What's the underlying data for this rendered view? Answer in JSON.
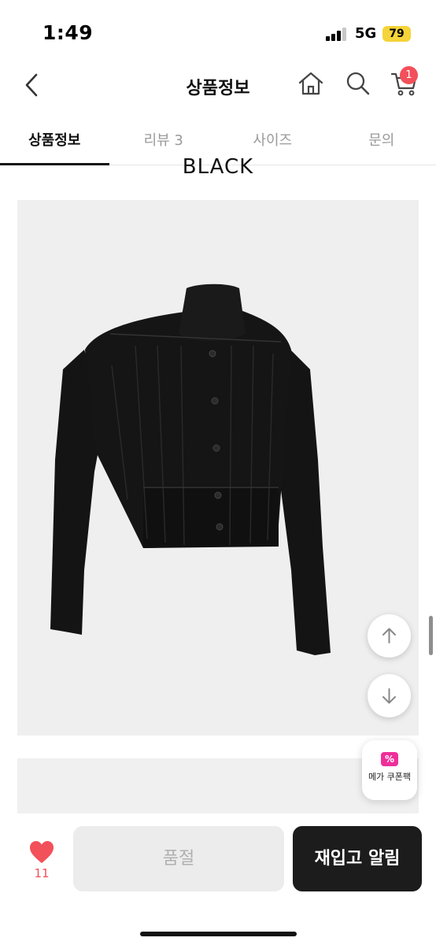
{
  "status_bar": {
    "time": "1:49",
    "network": "5G",
    "battery": "79"
  },
  "header": {
    "title": "상품정보",
    "cart_count": "1"
  },
  "tabs": [
    {
      "label": "상품정보",
      "active": true
    },
    {
      "label": "리뷰 3",
      "active": false
    },
    {
      "label": "사이즈",
      "active": false
    },
    {
      "label": "문의",
      "active": false
    }
  ],
  "content": {
    "color_label": "BLACK"
  },
  "coupon": {
    "label": "메가 쿠폰팩",
    "icon_glyph": "%"
  },
  "bottom_bar": {
    "like_count": "11",
    "soldout_label": "품절",
    "restock_label": "재입고 알림"
  },
  "icons": {
    "back": "chevron-left-icon",
    "home": "home-icon",
    "search": "search-icon",
    "cart": "cart-icon",
    "heart": "heart-icon",
    "up": "arrow-up-icon",
    "down": "arrow-down-icon",
    "coupon": "coupon-icon"
  },
  "colors": {
    "accent": "#f2505a",
    "coupon": "#ef2f9a",
    "primary_button": "#1c1c1c",
    "battery": "#f5d33a"
  }
}
